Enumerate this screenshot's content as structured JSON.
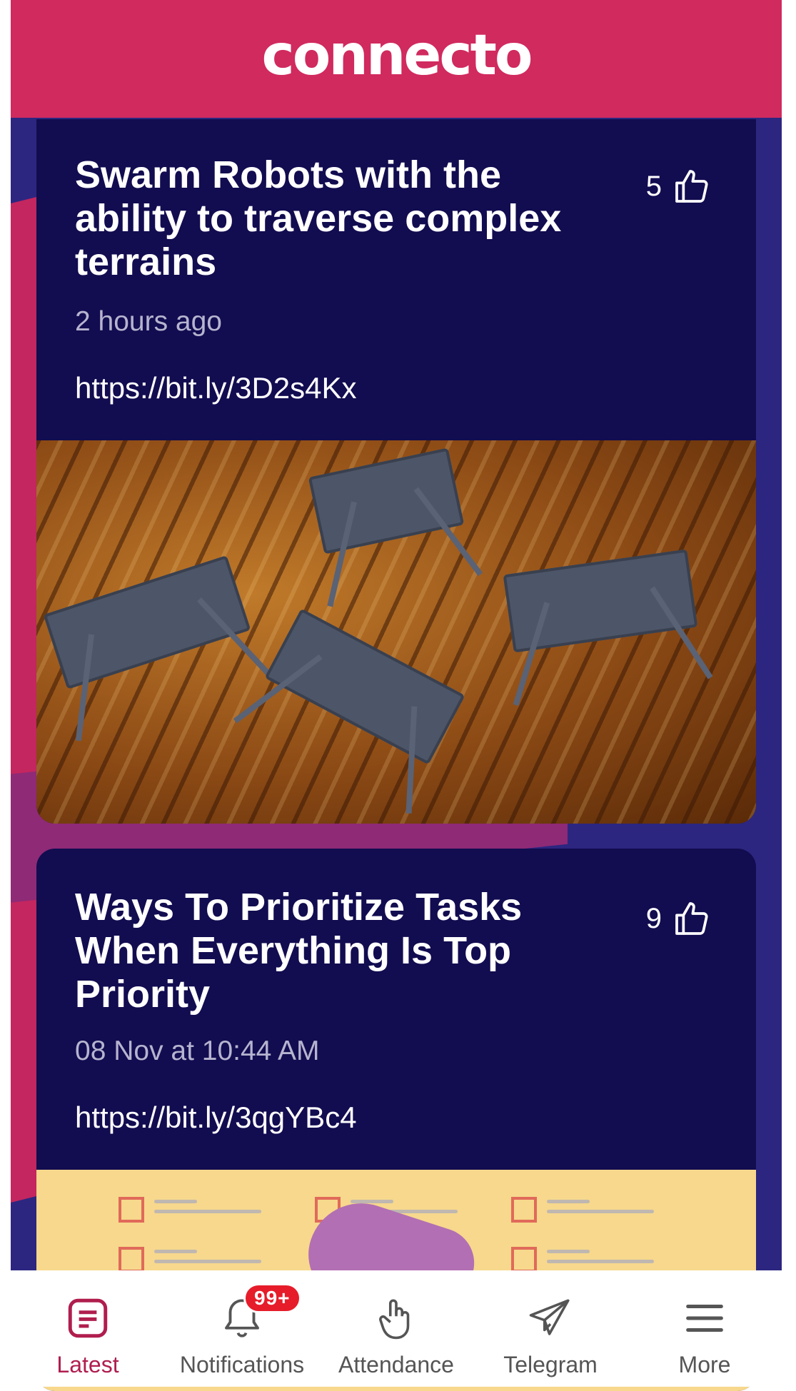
{
  "app": {
    "logo_text": "connecto"
  },
  "posts": [
    {
      "title": "Swarm Robots with the ability to traverse complex terrains",
      "time": "2 hours ago",
      "link": "https://bit.ly/3D2s4Kx",
      "likes": "5"
    },
    {
      "title": "Ways To Prioritize Tasks When Everything Is Top Priority",
      "time": "08 Nov at 10:44 AM",
      "link": "https://bit.ly/3qgYBc4",
      "likes": "9"
    }
  ],
  "tabbar": {
    "items": [
      {
        "label": "Latest",
        "icon": "document-icon",
        "active": true
      },
      {
        "label": "Notifications",
        "icon": "bell-icon",
        "badge": "99+"
      },
      {
        "label": "Attendance",
        "icon": "hand-pointer-icon"
      },
      {
        "label": "Telegram",
        "icon": "paper-plane-icon"
      },
      {
        "label": "More",
        "icon": "menu-icon"
      }
    ]
  },
  "colors": {
    "header": "#d02a5f",
    "card": "#120c50",
    "accent_active": "#b01e4e",
    "badge": "#e61c2a"
  }
}
